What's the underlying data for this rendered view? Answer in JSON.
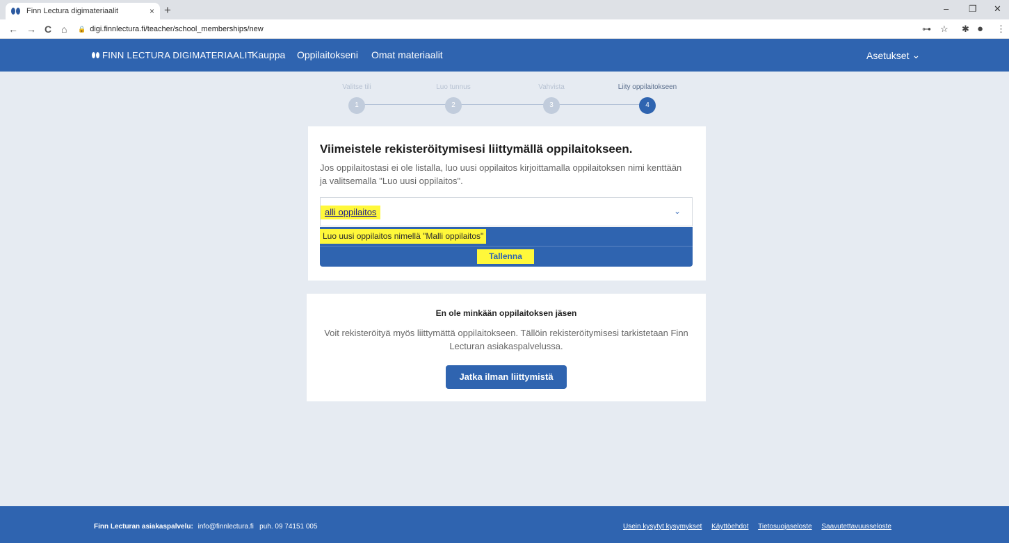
{
  "browser": {
    "tab_title": "Finn Lectura digimateriaalit",
    "tab_close": "×",
    "new_tab": "+",
    "url": "digi.finnlectura.fi/teacher/school_memberships/new",
    "back": "←",
    "forward": "→",
    "reload": "C",
    "home": "⌂",
    "lock": "🔒",
    "key": "⊶",
    "star": "☆",
    "extensions": "✱",
    "profile": "●",
    "menu": "⋮",
    "minimize": "–",
    "restore": "❐",
    "close": "✕"
  },
  "header": {
    "brand": "FINN LECTURA DIGIMATERIAALIT",
    "nav": [
      "Kauppa",
      "Oppilaitokseni",
      "Omat materiaalit"
    ],
    "settings": "Asetukset",
    "settings_chevron": "⌄"
  },
  "stepper": {
    "steps": [
      {
        "label": "Valitse tili",
        "number": "1"
      },
      {
        "label": "Luo tunnus",
        "number": "2"
      },
      {
        "label": "Vahvista",
        "number": "3"
      },
      {
        "label": "Liity oppilaitokseen",
        "number": "4"
      }
    ],
    "active_step": 4
  },
  "join_card": {
    "title": "Viimeistele rekisteröitymisesi liittymällä oppilaitokseen.",
    "description": "Jos oppilaitostasi ei ole listalla, luo uusi oppilaitos kirjoittamalla oppilaitoksen nimi kenttään ja valitsemalla \"Luo uusi oppilaitos\".",
    "input_value": "alli oppilaitos",
    "chevron": "⌄",
    "option": "Luo uusi oppilaitos nimellä \"Malli oppilaitos\"",
    "save_label": "Tallenna"
  },
  "no_school_card": {
    "title": "En ole minkään oppilaitoksen jäsen",
    "description": "Voit rekisteröityä myös liittymättä oppilaitokseen. Tällöin rekisteröitymisesi tarkistetaan Finn Lecturan asiakaspalvelussa.",
    "button_label": "Jatka ilman liittymistä"
  },
  "footer": {
    "service_label": "Finn Lecturan asiakaspalvelu:",
    "contact": "info@finnlectura.fi   puh. 09 74151 005",
    "links": [
      "Usein kysytyt kysymykset",
      "Käyttöehdot",
      "Tietosuojaseloste",
      "Saavutettavuusseloste"
    ]
  },
  "colors": {
    "brand_blue": "#2f64b0",
    "background": "#e6ebf2",
    "highlight": "#fff83a"
  }
}
